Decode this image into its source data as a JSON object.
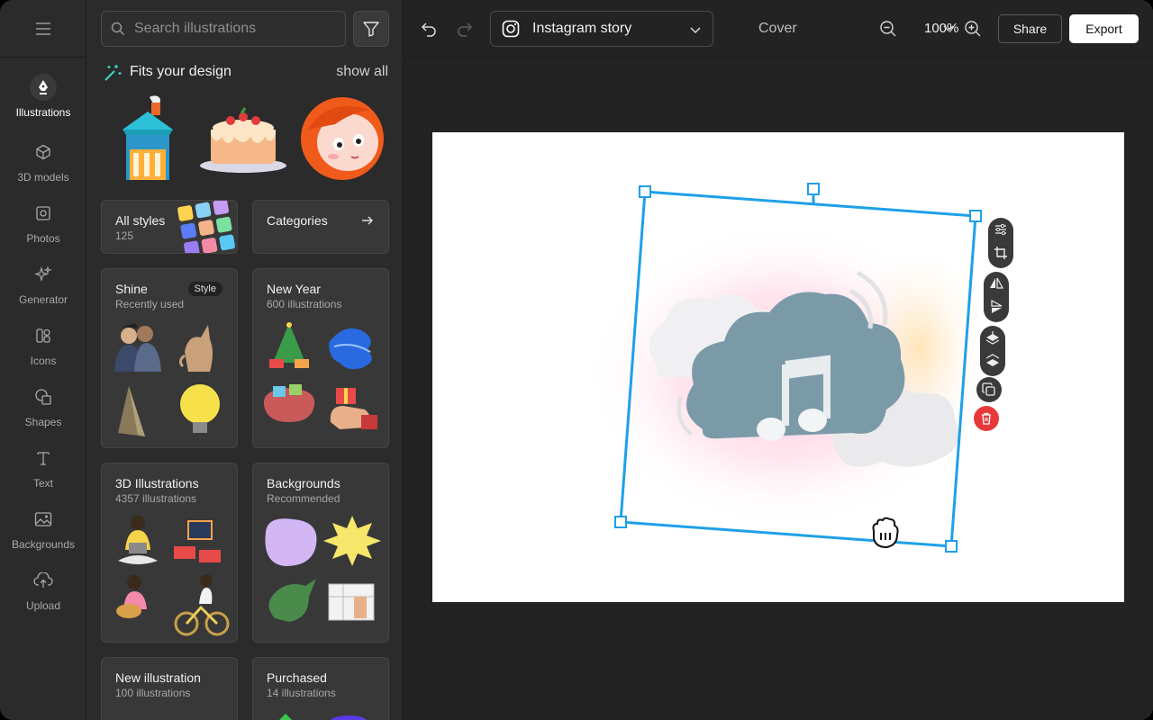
{
  "rail": {
    "items": [
      {
        "label": "Illustrations",
        "icon": "pen-nib-icon",
        "active": true
      },
      {
        "label": "3D models",
        "icon": "cube-icon"
      },
      {
        "label": "Photos",
        "icon": "photo-icon"
      },
      {
        "label": "Generator",
        "icon": "sparkles-icon"
      },
      {
        "label": "Icons",
        "icon": "icons-grid-icon"
      },
      {
        "label": "Shapes",
        "icon": "shapes-icon"
      },
      {
        "label": "Text",
        "icon": "text-icon"
      },
      {
        "label": "Backgrounds",
        "icon": "image-icon"
      },
      {
        "label": "Upload",
        "icon": "upload-cloud-icon"
      }
    ]
  },
  "panel": {
    "search_placeholder": "Search illustrations",
    "fits_title": "Fits your design",
    "show_all": "show all",
    "all_styles": {
      "title": "All styles",
      "count": "125"
    },
    "categories": {
      "title": "Categories"
    },
    "cards": [
      {
        "title": "Shine",
        "subtitle": "Recently used",
        "badge": "Style"
      },
      {
        "title": "New Year",
        "subtitle": "600 illustrations"
      },
      {
        "title": "3D Illustrations",
        "subtitle": "4357 illustrations"
      },
      {
        "title": "Backgrounds",
        "subtitle": "Recommended"
      },
      {
        "title": "New illustration",
        "subtitle": "100 illustrations"
      },
      {
        "title": "Purchased",
        "subtitle": "14 illustrations"
      }
    ]
  },
  "topbar": {
    "format_label": "Instagram story",
    "cover_label": "Cover",
    "zoom": "100%",
    "share_label": "Share",
    "export_label": "Export"
  },
  "colors": {
    "selection": "#1ea0e8",
    "delete": "#e8393a",
    "panel_bg": "#2b2b2b",
    "card_bg": "#383838"
  }
}
